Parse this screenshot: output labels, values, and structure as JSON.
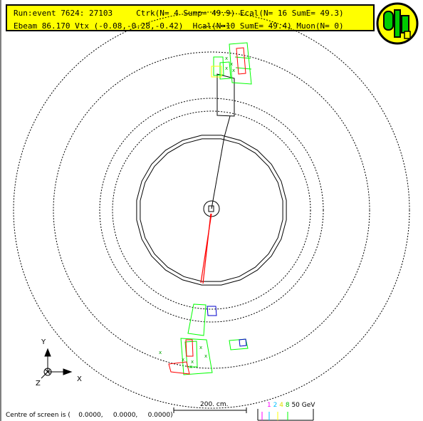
{
  "info": {
    "line1": "Run:event 7624: 27103     Ctrk(N= 4 Sump= 49.9) Ecal(N= 16 SumE= 49.3)",
    "line2": "Ebeam 86.170 Vtx (-0.08,-0.28,-0.42)  Hcal(N=10 SumE= 49.4) Muon(N= 0)"
  },
  "axes": {
    "y": "Y",
    "x": "X",
    "z": "Z"
  },
  "scale": {
    "label": "200. cm."
  },
  "energy_scale": {
    "values": [
      "1",
      "2",
      "4",
      "8",
      "50 GeV"
    ],
    "colors": [
      "#ff00ff",
      "#00c0ff",
      "#ffff00",
      "#00ff00",
      "#000000"
    ]
  },
  "status": "Centre of screen is (    0.0000,     0.0000,     0.0000)",
  "colors": {
    "info_background": "#ffff00",
    "track": "#ff0000",
    "ecal": "#00ff00",
    "hcal": "#00c000",
    "muon": "#0000ff"
  }
}
